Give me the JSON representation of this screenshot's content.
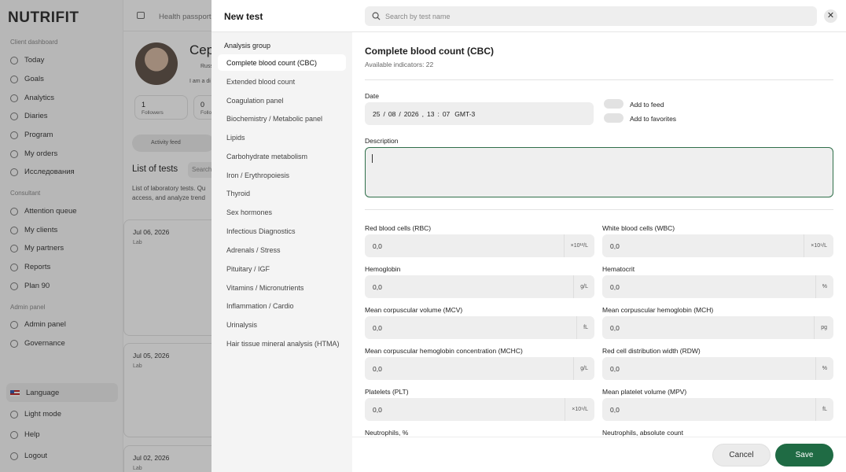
{
  "app": {
    "logo": "NUTRIFIT",
    "sections": {
      "client": "Client dashboard",
      "consultant": "Consultant",
      "admin": "Admin panel"
    },
    "client_items": [
      "Today",
      "Goals",
      "Analytics",
      "Diaries",
      "Program",
      "My orders",
      "Исследования"
    ],
    "consultant_items": [
      "Attention queue",
      "My clients",
      "My partners",
      "Reports",
      "Plan 90"
    ],
    "admin_items": [
      "Admin panel",
      "Governance"
    ],
    "bottom_items": {
      "language": "Language",
      "light_mode": "Light mode",
      "help": "Help",
      "logout": "Logout"
    },
    "topbar_tab": "Health passport",
    "profile": {
      "name_partial": "Сер",
      "location_partial": "Russ",
      "bio_partial": "I am a di",
      "followers_count": "1",
      "followers_label": "Followers",
      "second_count": "0",
      "second_label_partial": "Follo"
    },
    "feed_tab": "Activity feed",
    "tests_title": "List of tests",
    "tests_search_partial": "Search",
    "tests_desc_partial": [
      "List of laboratory tests. Qu",
      "access, and analyze trend"
    ],
    "test_cards": [
      {
        "date": "Jul 06, 2026",
        "type": "Lab"
      },
      {
        "date": "Jul 05, 2026",
        "type": "Lab"
      },
      {
        "date": "Jul 02, 2026",
        "type": "Lab"
      }
    ]
  },
  "modal": {
    "title": "New test",
    "search_placeholder": "Search by test name",
    "close_icon": "close-icon",
    "group_heading": "Analysis group",
    "groups": [
      "Complete blood count (CBC)",
      "Extended blood count",
      "Coagulation panel",
      "Biochemistry / Metabolic panel",
      "Lipids",
      "Carbohydrate metabolism",
      "Iron / Erythropoiesis",
      "Thyroid",
      "Sex hormones",
      "Infectious Diagnostics",
      "Adrenals / Stress",
      "Pituitary / IGF",
      "Vitamins / Micronutrients",
      "Inflammation / Cardio",
      "Urinalysis",
      "Hair tissue mineral analysis (HTMA)"
    ],
    "active_group_index": 0,
    "content": {
      "title": "Complete blood count (CBC)",
      "available": "Available indicators: 22",
      "date_label": "Date",
      "date_value": {
        "day": "25",
        "month": "08",
        "year": "2026",
        "hour": "13",
        "minute": "07",
        "tz": "GMT-3"
      },
      "add_to_feed": "Add to feed",
      "add_to_favorites": "Add to favorites",
      "add_to_feed_on": false,
      "add_to_favorites_on": false,
      "description_label": "Description",
      "fields": [
        {
          "label": "Red blood cells (RBC)",
          "value": "0,0",
          "unit": "×10¹²/L"
        },
        {
          "label": "White blood cells (WBC)",
          "value": "0,0",
          "unit": "×10⁹/L"
        },
        {
          "label": "Hemoglobin",
          "value": "0,0",
          "unit": "g/L"
        },
        {
          "label": "Hematocrit",
          "value": "0,0",
          "unit": "%"
        },
        {
          "label": "Mean corpuscular volume (MCV)",
          "value": "0,0",
          "unit": "fL"
        },
        {
          "label": "Mean corpuscular hemoglobin (MCH)",
          "value": "0,0",
          "unit": "pg"
        },
        {
          "label": "Mean corpuscular hemoglobin concentration (MCHC)",
          "value": "0,0",
          "unit": "g/L"
        },
        {
          "label": "Red cell distribution width (RDW)",
          "value": "0,0",
          "unit": "%"
        },
        {
          "label": "Platelets (PLT)",
          "value": "0,0",
          "unit": "×10⁹/L"
        },
        {
          "label": "Mean platelet volume (MPV)",
          "value": "0,0",
          "unit": "fL"
        },
        {
          "label": "Neutrophils, %",
          "value": "",
          "unit": ""
        },
        {
          "label": "Neutrophils, absolute count",
          "value": "",
          "unit": ""
        }
      ]
    },
    "cancel_label": "Cancel",
    "save_label": "Save",
    "colors": {
      "accent": "#1f6b44",
      "overlay": "rgba(30,30,30,0.30)"
    }
  }
}
